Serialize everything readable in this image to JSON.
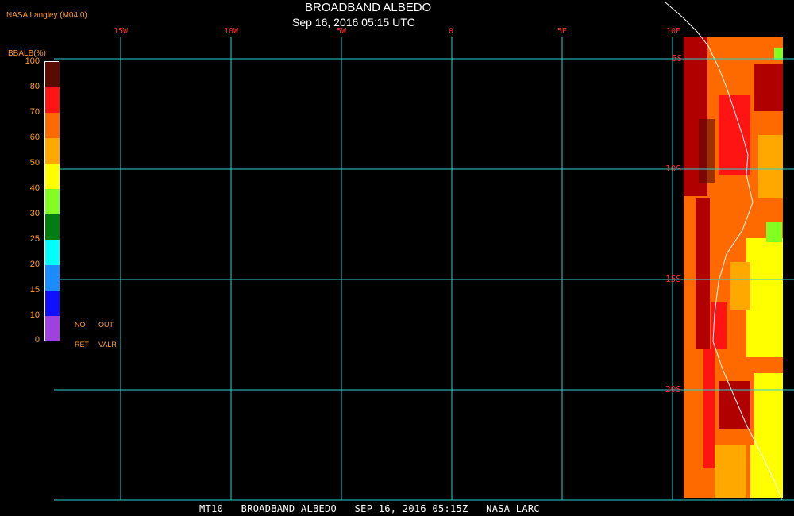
{
  "header": {
    "credit": "NASA Langley (M04.0)",
    "title": "BROADBAND ALBEDO",
    "subtitle": "Sep 16, 2016 05:15 UTC"
  },
  "colorbar": {
    "title": "BBALB(%)",
    "levels": [
      "0",
      "10",
      "15",
      "20",
      "25",
      "30",
      "40",
      "50",
      "60",
      "70",
      "80",
      "100"
    ],
    "colors": [
      "#a040e0",
      "#1010ff",
      "#1a8cff",
      "#00ffff",
      "#007f10",
      "#80ff20",
      "#ffff00",
      "#ffa800",
      "#ff6a00",
      "#ff1414",
      "#b00000",
      "#5a0a00"
    ],
    "legend_no": "NO",
    "legend_ret": "RET",
    "legend_out": "OUT",
    "legend_valr": "VALR"
  },
  "longitude_labels": [
    "15W",
    "10W",
    "5W",
    "0",
    "5E",
    "10E"
  ],
  "latitude_labels": [
    "5S",
    "10S",
    "15S",
    "20S"
  ],
  "footer": {
    "text": "MT10   BROADBAND ALBEDO   SEP 16, 2016 05:15Z   NASA LARC"
  },
  "colors": {
    "grid": "#2ad2d2",
    "label_orange": "#ff9a2e",
    "label_red": "#ff2a2a",
    "background": "#000000",
    "coastline": "#ffffff"
  }
}
